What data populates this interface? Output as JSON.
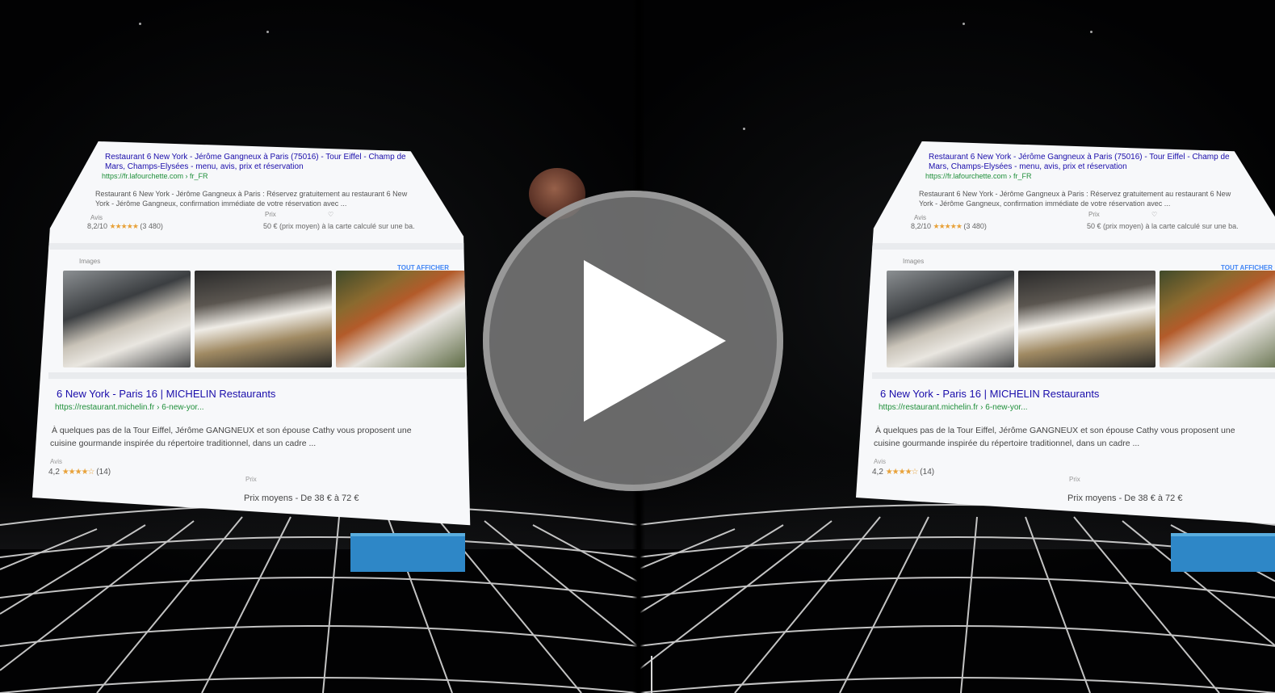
{
  "scene": {
    "type": "stereoscopic-vr-video-thumbnail",
    "eyes": [
      "left",
      "right"
    ]
  },
  "search_panel": {
    "top_result": {
      "title_line1": "Restaurant 6 New York - Jérôme Gangneux à Paris (75016) - Tour Eiffel - Champ de",
      "title_line2": "Mars, Champs-Elysées - menu, avis, prix et réservation",
      "url": "https://fr.lafourchette.com › fr_FR",
      "snippet_line1": "Restaurant 6 New York - Jérôme Gangneux à Paris : Réservez gratuitement au restaurant 6 New",
      "snippet_line2": "York - Jérôme Gangneux, confirmation immédiate de votre réservation avec ...",
      "rating_label": "Avis",
      "rating": "8,2/10",
      "stars": "★★★★★",
      "rating_count": "(3 480)",
      "price_label": "Prix",
      "price": "50 € (prix moyen) à la carte calculé sur une ba."
    },
    "images": {
      "heading": "Images",
      "see_all": "TOUT AFFICHER"
    },
    "michelin_result": {
      "title": "6 New York - Paris 16 | MICHELIN Restaurants",
      "url": "https://restaurant.michelin.fr › 6-new-yor...",
      "snippet_line1": "À quelques pas de la Tour Eiffel, Jérôme GANGNEUX et son épouse Cathy vous proposent une",
      "snippet_line2": "cuisine gourmande inspirée du répertoire traditionnel, dans un cadre ...",
      "rating_label": "Avis",
      "rating": "4,2",
      "stars": "★★★★☆",
      "rating_count": "(14)",
      "price_label": "Prix",
      "price": "Prix moyens - De 38 € à 72 €"
    }
  },
  "colors": {
    "link": "#1a0dab",
    "url": "#1f8f3a",
    "accent_block": "#2e87c7",
    "play_button": "#808080"
  },
  "controls": {
    "play_icon": "play-icon"
  }
}
